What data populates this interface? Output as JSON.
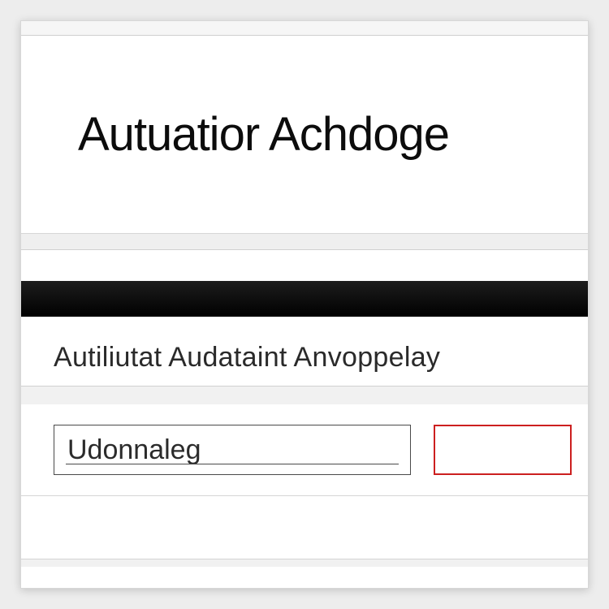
{
  "header": {
    "title": "Autuatior Achdoge"
  },
  "section": {
    "label": "Autiliutat Audataint Anvoppelay"
  },
  "form": {
    "input_value": "Udonnaleg",
    "action_label": ""
  }
}
